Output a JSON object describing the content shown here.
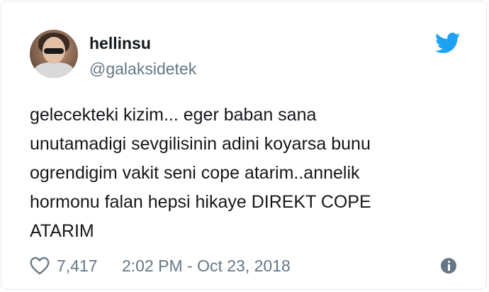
{
  "tweet": {
    "display_name": "hellinsu",
    "handle": "@galaksidetek",
    "text_lines": [
      "gelecekteki kizim... eger baban sana",
      "unutamadigi sevgilisinin adini koyarsa bunu",
      "ogrendigim vakit seni cope atarim..annelik",
      "hormonu falan hepsi hikaye DIREKT COPE",
      "ATARIM"
    ],
    "likes": "7,417",
    "timestamp": "2:02 PM - Oct 23, 2018"
  },
  "icons": {
    "brand": "twitter-bird-icon",
    "like": "heart-icon",
    "info": "info-icon"
  },
  "colors": {
    "brand_blue": "#1da1f2",
    "text": "#14171a",
    "muted": "#657786",
    "border": "#e1e8ed"
  }
}
